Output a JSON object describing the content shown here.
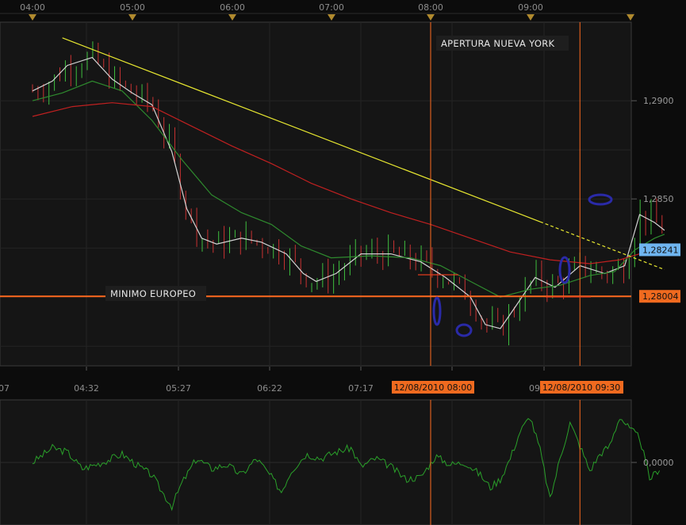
{
  "chart_data": {
    "type": "line",
    "top_axis": {
      "labels": [
        "04:00",
        "05:00",
        "06:00",
        "07:00",
        "08:00",
        "09:00"
      ]
    },
    "bottom_axis": {
      "labels": [
        "07",
        "04:32",
        "05:27",
        "06:22",
        "07:17",
        "09"
      ]
    },
    "price_panel": {
      "ylim": [
        1.2765,
        1.294
      ],
      "ticks": [
        {
          "value": 1.29,
          "label": "1,2900"
        },
        {
          "value": 1.285,
          "label": "1,2850"
        }
      ],
      "last_price": {
        "value": 1.28241,
        "label": "1,28241"
      },
      "support": {
        "value": 1.28004,
        "label": "1,28004",
        "color": "#ff6a1f"
      },
      "trendline": {
        "color": "#e8e830",
        "from": {
          "t": 0.3,
          "y": 1.2932
        },
        "to": {
          "t": 6.35,
          "y": 1.2814
        }
      },
      "series": [
        {
          "color": "#d2d2d2",
          "values": [
            [
              0.0,
              1.2905
            ],
            [
              0.2,
              1.291
            ],
            [
              0.35,
              1.2918
            ],
            [
              0.6,
              1.2922
            ],
            [
              0.8,
              1.2911
            ],
            [
              1.0,
              1.2904
            ],
            [
              1.2,
              1.2898
            ],
            [
              1.4,
              1.2874
            ],
            [
              1.55,
              1.2845
            ],
            [
              1.7,
              1.283
            ],
            [
              1.85,
              1.2827
            ],
            [
              2.1,
              1.283
            ],
            [
              2.3,
              1.2828
            ],
            [
              2.55,
              1.2822
            ],
            [
              2.72,
              1.2812
            ],
            [
              2.85,
              1.2808
            ],
            [
              3.05,
              1.2812
            ],
            [
              3.3,
              1.2822
            ],
            [
              3.6,
              1.2822
            ],
            [
              3.9,
              1.2818
            ],
            [
              4.15,
              1.281
            ],
            [
              4.4,
              1.28
            ],
            [
              4.55,
              1.2786
            ],
            [
              4.7,
              1.2784
            ],
            [
              4.85,
              1.2795
            ],
            [
              5.05,
              1.281
            ],
            [
              5.25,
              1.2805
            ],
            [
              5.5,
              1.2816
            ],
            [
              5.75,
              1.2812
            ],
            [
              5.95,
              1.2816
            ],
            [
              6.1,
              1.2842
            ],
            [
              6.25,
              1.2838
            ],
            [
              6.35,
              1.2834
            ]
          ]
        },
        {
          "color": "#2e8a2e",
          "values": [
            [
              0.0,
              1.29
            ],
            [
              0.3,
              1.2904
            ],
            [
              0.6,
              1.291
            ],
            [
              0.9,
              1.2905
            ],
            [
              1.2,
              1.289
            ],
            [
              1.5,
              1.287
            ],
            [
              1.8,
              1.2852
            ],
            [
              2.1,
              1.2843
            ],
            [
              2.4,
              1.2837
            ],
            [
              2.7,
              1.2826
            ],
            [
              3.0,
              1.282
            ],
            [
              3.4,
              1.2821
            ],
            [
              3.8,
              1.282
            ],
            [
              4.1,
              1.2816
            ],
            [
              4.4,
              1.2808
            ],
            [
              4.7,
              1.28
            ],
            [
              5.0,
              1.2804
            ],
            [
              5.3,
              1.2806
            ],
            [
              5.6,
              1.2811
            ],
            [
              5.85,
              1.2813
            ],
            [
              6.05,
              1.2824
            ],
            [
              6.25,
              1.283
            ],
            [
              6.35,
              1.2832
            ]
          ]
        },
        {
          "color": "#c02020",
          "values": [
            [
              0.0,
              1.2892
            ],
            [
              0.4,
              1.2897
            ],
            [
              0.8,
              1.2899
            ],
            [
              1.2,
              1.2897
            ],
            [
              1.6,
              1.2887
            ],
            [
              2.0,
              1.2877
            ],
            [
              2.4,
              1.2868
            ],
            [
              2.8,
              1.2858
            ],
            [
              3.2,
              1.285
            ],
            [
              3.6,
              1.2843
            ],
            [
              4.0,
              1.2837
            ],
            [
              4.4,
              1.283
            ],
            [
              4.8,
              1.2823
            ],
            [
              5.2,
              1.2819
            ],
            [
              5.6,
              1.2817
            ],
            [
              5.9,
              1.2819
            ],
            [
              6.1,
              1.2822
            ],
            [
              6.35,
              1.2824
            ]
          ]
        }
      ]
    },
    "oscillator_panel": {
      "ylim": [
        -1.5,
        1.5
      ],
      "ticks": [
        {
          "value": 0,
          "label": "0,0000"
        }
      ],
      "color": "#2aa02a",
      "values": [
        [
          0.0,
          0.0
        ],
        [
          0.2,
          0.35
        ],
        [
          0.35,
          0.25
        ],
        [
          0.5,
          -0.15
        ],
        [
          0.7,
          0.0
        ],
        [
          0.9,
          0.2
        ],
        [
          1.1,
          -0.15
        ],
        [
          1.2,
          -0.3
        ],
        [
          1.3,
          -0.7
        ],
        [
          1.4,
          -1.05
        ],
        [
          1.5,
          -0.5
        ],
        [
          1.65,
          0.1
        ],
        [
          1.8,
          -0.15
        ],
        [
          1.95,
          -0.05
        ],
        [
          2.1,
          -0.3
        ],
        [
          2.25,
          0.1
        ],
        [
          2.4,
          -0.35
        ],
        [
          2.5,
          -0.7
        ],
        [
          2.6,
          -0.2
        ],
        [
          2.75,
          0.2
        ],
        [
          2.9,
          0.1
        ],
        [
          3.05,
          0.25
        ],
        [
          3.2,
          0.35
        ],
        [
          3.3,
          -0.1
        ],
        [
          3.45,
          0.1
        ],
        [
          3.6,
          -0.1
        ],
        [
          3.75,
          -0.4
        ],
        [
          3.9,
          -0.35
        ],
        [
          4.05,
          0.15
        ],
        [
          4.2,
          -0.05
        ],
        [
          4.35,
          0.0
        ],
        [
          4.5,
          -0.3
        ],
        [
          4.6,
          -0.6
        ],
        [
          4.7,
          -0.4
        ],
        [
          4.8,
          0.1
        ],
        [
          4.9,
          0.75
        ],
        [
          5.0,
          1.1
        ],
        [
          5.1,
          0.3
        ],
        [
          5.2,
          -0.9
        ],
        [
          5.3,
          0.1
        ],
        [
          5.4,
          0.95
        ],
        [
          5.5,
          0.4
        ],
        [
          5.6,
          -0.2
        ],
        [
          5.7,
          0.2
        ],
        [
          5.8,
          0.4
        ],
        [
          5.9,
          1.1
        ],
        [
          6.0,
          0.8
        ],
        [
          6.1,
          0.6
        ],
        [
          6.2,
          -0.4
        ],
        [
          6.3,
          -0.15
        ]
      ]
    },
    "vertical_markers": [
      {
        "t": 4.0,
        "label": "12/08/2010 08:00",
        "color": "#ff6a1f"
      },
      {
        "t": 5.5,
        "label": "12/08/2010 09:30",
        "color": "#ff6a1f"
      }
    ],
    "annotations": [
      {
        "text": "APERTURA NUEVA YORK"
      },
      {
        "text": "MINIMO EUROPEO"
      }
    ],
    "grid": true
  }
}
